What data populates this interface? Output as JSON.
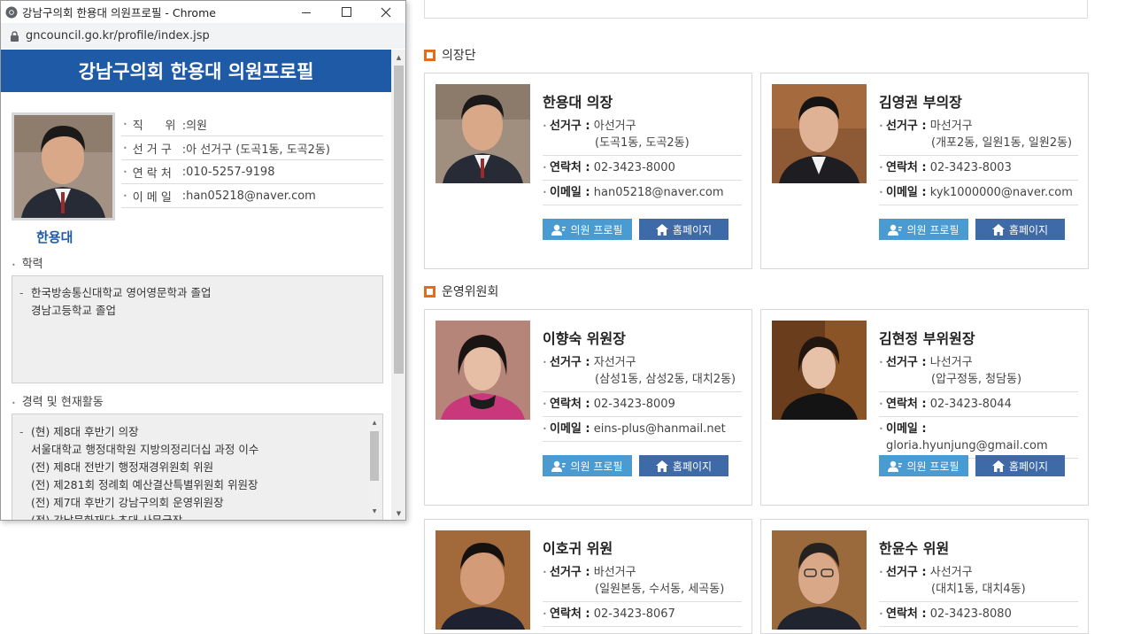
{
  "popup": {
    "window_title": "강남구의회 한용대 의원프로필 - Chrome",
    "url": "gncouncil.go.kr/profile/index.jsp",
    "header": "강남구의회 한용대 의원프로필",
    "name": "한용대",
    "fields": [
      {
        "label": "직      위",
        "value": ":의원"
      },
      {
        "label": "선 거 구",
        "value": ":아 선거구 (도곡1동, 도곡2동)"
      },
      {
        "label": "연 락 처",
        "value": ":010-5257-9198"
      },
      {
        "label": "이 메 일",
        "value": ":han05218@naver.com"
      }
    ],
    "education_title": "학력",
    "education": [
      "한국방송통신대학교 영어영문학과 졸업",
      "경남고등학교 졸업"
    ],
    "career_title": "경력 및 현재활동",
    "career": [
      "(현) 제8대 후반기 의장",
      "서울대학교 행정대학원 지방의정리더십 과정 이수",
      "(전) 제8대 전반기 행정재경위원회 위원",
      "(전) 제281회 정례회 예산결산특별위원회 위원장",
      "(전) 제7대 후반기 강남구의회 운영위원장",
      "(전) 강남문화재단 초대 사무국장"
    ]
  },
  "sections": [
    {
      "title": "의장단",
      "cards": [
        {
          "name": "한용대 의장",
          "district_label": "선거구 :",
          "district": "아선거구",
          "district_sub": "(도곡1동, 도곡2동)",
          "phone_label": "연락처 :",
          "phone": "02-3423-8000",
          "email_label": "이메일 :",
          "email": "han05218@naver.com",
          "profile_btn": "의원 프로필",
          "home_btn": "홈페이지"
        },
        {
          "name": "김영권 부의장",
          "district_label": "선거구 :",
          "district": "마선거구",
          "district_sub": "(개포2동, 일원1동, 일원2동)",
          "phone_label": "연락처 :",
          "phone": "02-3423-8003",
          "email_label": "이메일 :",
          "email": "kyk1000000@naver.com",
          "profile_btn": "의원 프로필",
          "home_btn": "홈페이지"
        }
      ]
    },
    {
      "title": "운영위원회",
      "cards": [
        {
          "name": "이향숙 위원장",
          "district_label": "선거구 :",
          "district": "자선거구",
          "district_sub": "(삼성1동, 삼성2동, 대치2동)",
          "phone_label": "연락처 :",
          "phone": "02-3423-8009",
          "email_label": "이메일 :",
          "email": "eins-plus@hanmail.net",
          "profile_btn": "의원 프로필",
          "home_btn": "홈페이지"
        },
        {
          "name": "김현정 부위원장",
          "district_label": "선거구 :",
          "district": "나선거구",
          "district_sub": "(압구정동, 청담동)",
          "phone_label": "연락처 :",
          "phone": "02-3423-8044",
          "email_label": "이메일 :",
          "email": "gloria.hyunjung@gmail.com",
          "profile_btn": "의원 프로필",
          "home_btn": "홈페이지"
        },
        {
          "name": "이호귀 위원",
          "district_label": "선거구 :",
          "district": "바선거구",
          "district_sub": "(일원본동, 수서동, 세곡동)",
          "phone_label": "연락처 :",
          "phone": "02-3423-8067",
          "email_label": "",
          "email": "",
          "profile_btn": "",
          "home_btn": ""
        },
        {
          "name": "한윤수 위원",
          "district_label": "선거구 :",
          "district": "사선거구",
          "district_sub": "(대치1동, 대치4동)",
          "phone_label": "연락처 :",
          "phone": "02-3423-8080",
          "email_label": "",
          "email": "",
          "profile_btn": "",
          "home_btn": ""
        }
      ]
    }
  ],
  "colors": {
    "header_blue": "#1f5aa6",
    "profile_btn": "#4a9bd1",
    "home_btn": "#3e6aa8",
    "section_square": "#e46c1b"
  }
}
